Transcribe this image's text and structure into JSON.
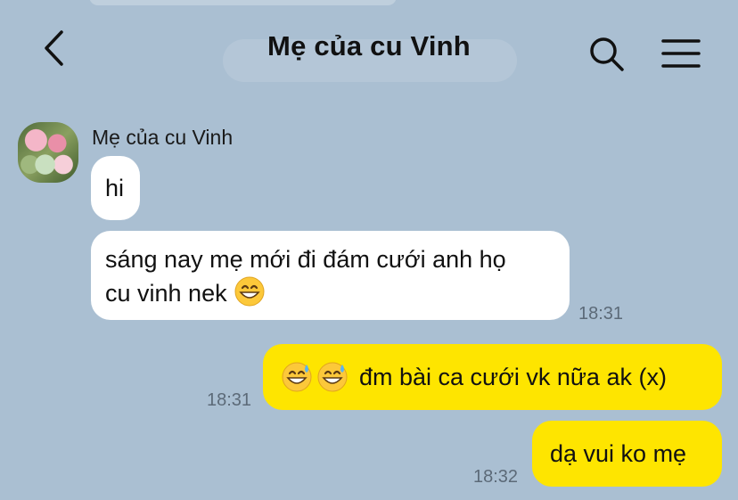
{
  "header": {
    "title": "Mẹ của cu Vinh"
  },
  "messages": [
    {
      "sender": "Mẹ của cu Vinh",
      "text": "hi"
    },
    {
      "text_line1": "sáng nay mẹ mới đi đám cưới anh họ",
      "text_line2": "cu vinh nek",
      "emoji": "grinning-face",
      "time": "18:31"
    },
    {
      "text": "đm bài ca cưới vk nữa ak (x)",
      "emoji": "grinning-sweat-face",
      "time": "18:31"
    },
    {
      "text": "dạ vui ko mẹ",
      "time": "18:32"
    }
  ],
  "colors": {
    "background": "#aabfd2",
    "incoming_bubble": "#ffffff",
    "outgoing_bubble": "#fee500"
  },
  "icons": [
    "back-arrow-icon",
    "search-icon",
    "menu-icon"
  ]
}
